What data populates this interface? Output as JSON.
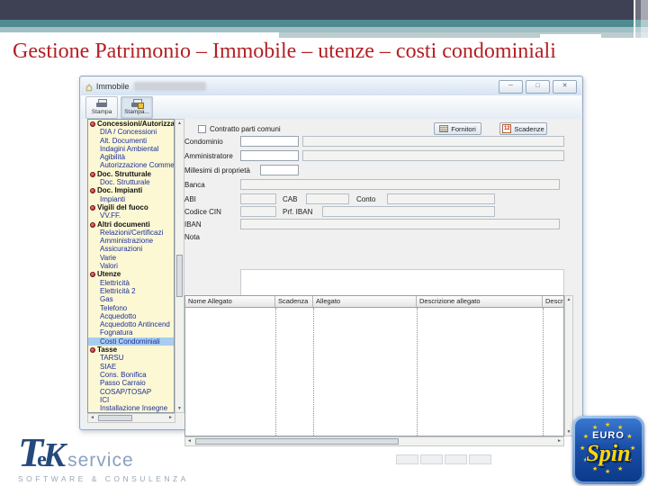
{
  "slide": {
    "title": "Gestione Patrimonio – Immobile – utenze – costi condominiali"
  },
  "icons": {
    "house": "⌂",
    "up": "▲",
    "down": "▼",
    "left": "◄",
    "right": "►",
    "star": "★"
  },
  "window": {
    "title": "Immobile",
    "controls": [
      {
        "name": "minimize",
        "glyph": "─"
      },
      {
        "name": "maximize",
        "glyph": "□"
      },
      {
        "name": "close",
        "glyph": "✕"
      }
    ],
    "toolbar": [
      {
        "label": "Stampa"
      },
      {
        "label": "Stampa..."
      }
    ],
    "tree": [
      {
        "label": "Concessioni/Autorizzazio",
        "type": "group"
      },
      {
        "label": "DIA / Concessioni",
        "type": "item"
      },
      {
        "label": "Alt. Documenti",
        "type": "item"
      },
      {
        "label": "Indagini Ambiental",
        "type": "item"
      },
      {
        "label": "Agibilità",
        "type": "item"
      },
      {
        "label": "Autorizzazione Commercial",
        "type": "item"
      },
      {
        "label": "Doc. Strutturale",
        "type": "group"
      },
      {
        "label": "Doc. Strutturale",
        "type": "item"
      },
      {
        "label": "Doc. Impianti",
        "type": "group"
      },
      {
        "label": "Impianti",
        "type": "item"
      },
      {
        "label": "Vigili del fuoco",
        "type": "group"
      },
      {
        "label": "VV.FF.",
        "type": "item"
      },
      {
        "label": "Altri documenti",
        "type": "group"
      },
      {
        "label": "Relazioni/Certificazi",
        "type": "item"
      },
      {
        "label": "Amministrazione",
        "type": "item"
      },
      {
        "label": "Assicurazioni",
        "type": "item"
      },
      {
        "label": "Varie",
        "type": "item"
      },
      {
        "label": "Valori",
        "type": "item"
      },
      {
        "label": "Utenze",
        "type": "group"
      },
      {
        "label": "Elettricità",
        "type": "item"
      },
      {
        "label": "Elettricità 2",
        "type": "item"
      },
      {
        "label": "Gas",
        "type": "item"
      },
      {
        "label": "Telefono",
        "type": "item"
      },
      {
        "label": "Acquedotto",
        "type": "item"
      },
      {
        "label": "Acquedotto Antincend",
        "type": "item"
      },
      {
        "label": "Fognatura",
        "type": "item"
      },
      {
        "label": "Costi Condominiali",
        "type": "item",
        "selected": true
      },
      {
        "label": "Tasse",
        "type": "group"
      },
      {
        "label": "TARSU",
        "type": "item"
      },
      {
        "label": "SIAE",
        "type": "item"
      },
      {
        "label": "Cons. Bonifica",
        "type": "item"
      },
      {
        "label": "Passo Carraio",
        "type": "item"
      },
      {
        "label": "COSAP/TOSAP",
        "type": "item"
      },
      {
        "label": "ICI",
        "type": "item"
      },
      {
        "label": "Installazione Insegne",
        "type": "item"
      }
    ],
    "form": {
      "contract_checkbox": "Contratto parti comuni",
      "fornitori_button": "Fornitori",
      "scadenze_button": "Scadenze",
      "scadenze_icon": "12",
      "labels": {
        "condominio": "Condominio",
        "amministratore": "Amministratore",
        "millesimi": "Millesimi di proprietà",
        "banca": "Banca",
        "abi": "ABI",
        "cab": "CAB",
        "conto": "Conto",
        "cin": "Codice CIN",
        "prf_iban": "Prf. IBAN",
        "iban": "IBAN",
        "nota": "Nota"
      }
    },
    "attachments_table": {
      "columns": [
        "Nome Allegato",
        "Scadenza",
        "Allegato",
        "Descrizione allegato",
        "Descrizione Tip"
      ]
    }
  },
  "footer": {
    "tek": {
      "t": "T",
      "e": "e",
      "k": "K",
      "service": "service",
      "tagline": "SOFTWARE & CONSULENZA"
    },
    "eurospin": {
      "euro": "EURO",
      "spin": "Spin"
    }
  }
}
